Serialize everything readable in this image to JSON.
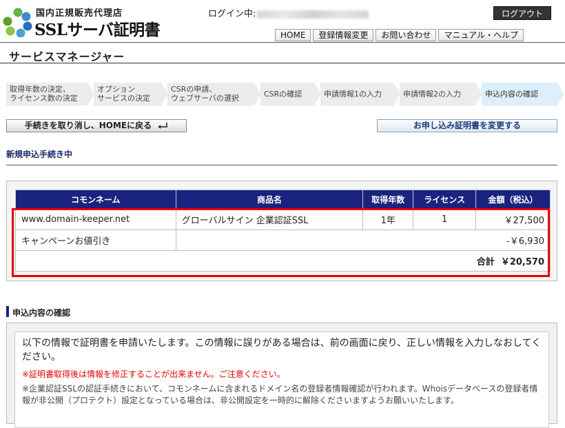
{
  "header": {
    "logo_top": "国内正規販売代理店",
    "logo_main": "SSLサーバ証明書",
    "login_label": "ログイン中:",
    "logout_label": "ログアウト",
    "nav": [
      "HOME",
      "登録情報変更",
      "お問い合わせ",
      "マニュアル・ヘルプ"
    ]
  },
  "page_title": "サービスマネージャー",
  "steps": [
    {
      "label": "取得年数の決定、\nライセンス数の決定",
      "current": false
    },
    {
      "label": "オプション\nサービスの決定",
      "current": false
    },
    {
      "label": "CSRの申請、\nウェブサーバの選択",
      "current": false
    },
    {
      "label": "CSRの確認",
      "current": false
    },
    {
      "label": "申請情報1の入力",
      "current": false
    },
    {
      "label": "申請情報2の入力",
      "current": false
    },
    {
      "label": "申込内容の確認",
      "current": true
    }
  ],
  "buttons": {
    "cancel_label": "手続きを取り消し、HOMEに戻る",
    "change_label": "お申し込み証明書を変更する"
  },
  "status_heading": "新規申込手続き中",
  "order": {
    "headers": [
      "コモンネーム",
      "商品名",
      "取得年数",
      "ライセンス",
      "金額（税込）"
    ],
    "row": {
      "common_name": "www.domain-keeper.net",
      "product": "グローバルサイン 企業認証SSL",
      "years": "1年",
      "licenses": "1",
      "amount": "￥27,500"
    },
    "discount": {
      "label": "キャンペーンお値引き",
      "amount": "-￥6,930"
    },
    "total": {
      "label": "合計",
      "amount": "￥20,570"
    }
  },
  "confirm": {
    "heading": "申込内容の確認",
    "main_text": "以下の情報で証明書を申請いたします。この情報に誤りがある場合は、前の画面に戻り、正しい情報を入力しなおしてください。",
    "warning": "※証明書取得後は情報を修正することが出来ません。ご注意ください。",
    "note": "※企業認証SSLの認証手続きにおいて、コモンネームに含まれるドメイン名の登録者情報確認が行われます。Whoisデータベースの登録者情報が非公開（プロテクト）設定となっている場合は、非公開設定を一時的に解除くださいますようお願いいたします。"
  },
  "colors": {
    "table_header_bg": "#1a237e",
    "highlight_frame": "#e30000",
    "current_step_bg": "#ddeffb",
    "warning_text": "#e60000"
  }
}
